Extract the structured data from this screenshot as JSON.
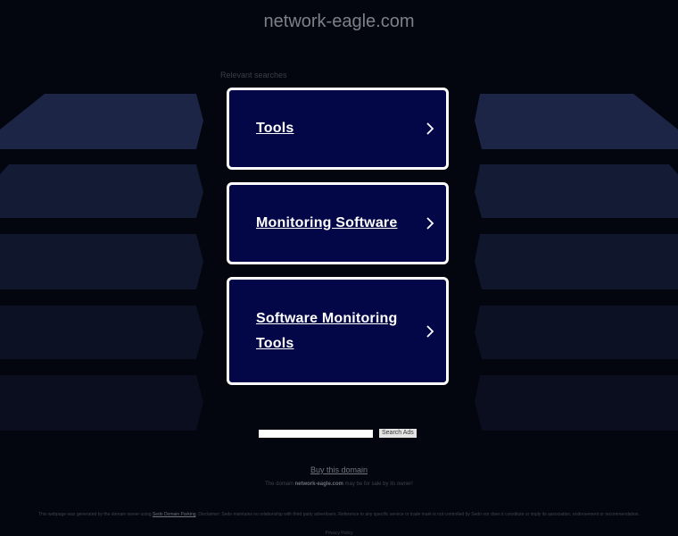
{
  "domain": "network-eagle.com",
  "relevant_label": "Relevant searches",
  "cards": [
    {
      "label": "Tools"
    },
    {
      "label": "Monitoring Software"
    },
    {
      "label": "Software Monitoring Tools"
    }
  ],
  "search": {
    "input_value": "",
    "button_label": "Search Ads"
  },
  "buy_link": "Buy this domain",
  "sale_notice": {
    "prefix": "The domain",
    "domain": "network-eagle.com",
    "suffix": "may be for sale by its owner!"
  },
  "disclaimer": {
    "before_link": "This webpage was generated by the domain owner using",
    "link_text": "Sedo Domain Parking",
    "after_link": ". Disclaimer: Sedo maintains no relationship with third party advertisers. Reference to any specific service or trade mark is not controlled by Sedo nor does it constitute or imply its association, endorsement or recommendation."
  },
  "privacy_link": "Privacy Policy",
  "colors": {
    "background": "#03060f",
    "card_fill": "#030647",
    "card_border": "#ffffff",
    "decor_blue": "#1c2545"
  },
  "icons": {
    "card_arrow": "chevron-right-icon"
  }
}
